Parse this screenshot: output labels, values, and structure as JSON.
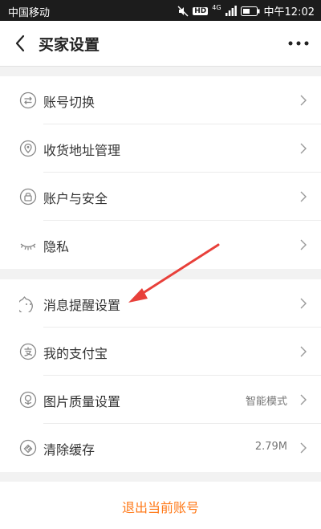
{
  "status_bar": {
    "carrier": "中国移动",
    "network": "4G",
    "hd": "HD",
    "time": "中午12:02",
    "icons": [
      "mute-icon",
      "hd-icon",
      "signal-icon",
      "battery-icon"
    ]
  },
  "header": {
    "title": "买家设置",
    "back_icon": "chevron-left-icon",
    "more_icon": "more-dots-icon"
  },
  "groups": [
    {
      "items": [
        {
          "label": "账号切换",
          "icon": "switch-account-icon"
        },
        {
          "label": "收货地址管理",
          "icon": "location-icon"
        },
        {
          "label": "账户与安全",
          "icon": "lock-icon"
        },
        {
          "label": "隐私",
          "icon": "eye-closed-icon"
        }
      ]
    },
    {
      "items": [
        {
          "label": "消息提醒设置",
          "icon": "notification-icon"
        },
        {
          "label": "我的支付宝",
          "icon": "alipay-icon"
        },
        {
          "label": "图片质量设置",
          "icon": "image-quality-icon",
          "value": "智能模式"
        },
        {
          "label": "清除缓存",
          "icon": "clear-cache-icon",
          "value": "2.79M"
        }
      ]
    }
  ],
  "logout_label": "退出当前账号",
  "colors": {
    "accent": "#ff7a1a",
    "annotation_arrow": "#e8403a",
    "status_bar": "#1c1c1c",
    "background": "#f2f2f2"
  }
}
